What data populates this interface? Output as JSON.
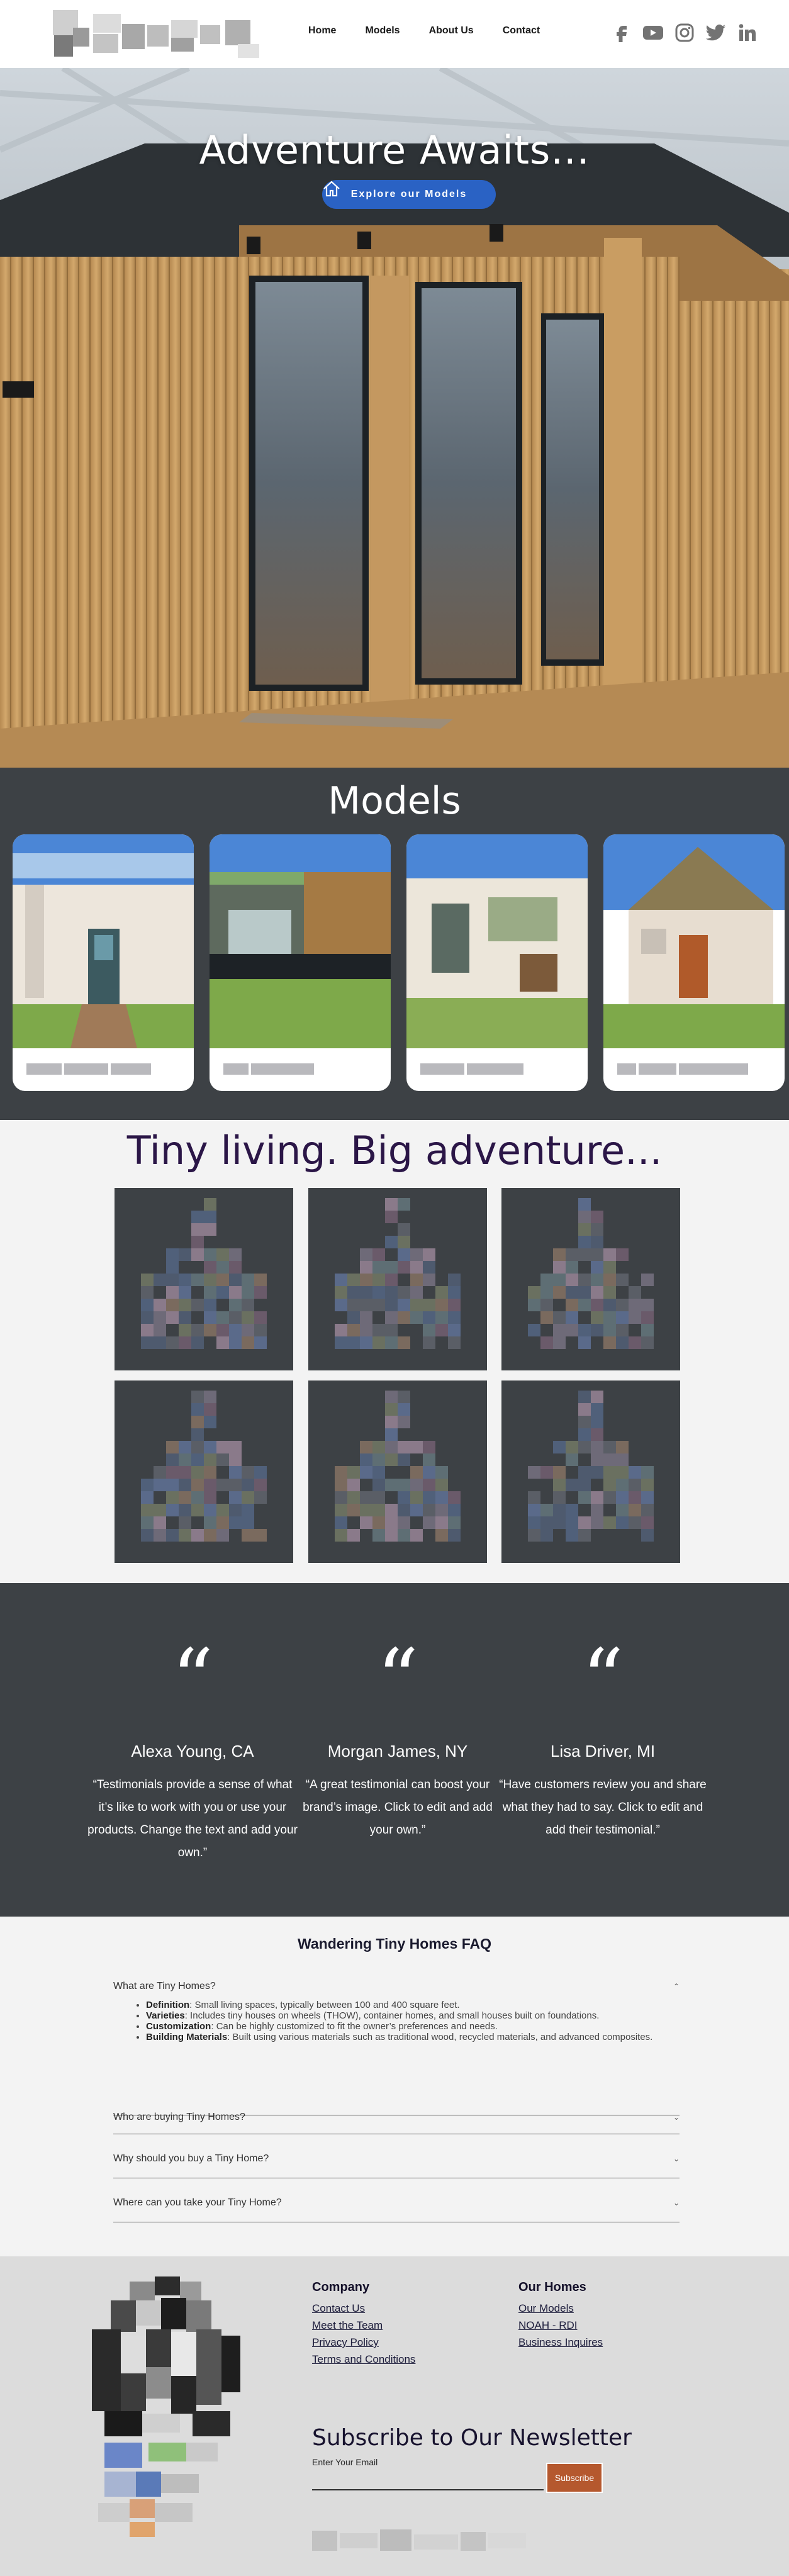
{
  "header": {
    "nav": [
      {
        "label": "Home"
      },
      {
        "label": "Models"
      },
      {
        "label": "About Us"
      },
      {
        "label": "Contact"
      }
    ],
    "social_icons": [
      "facebook-icon",
      "youtube-icon",
      "instagram-icon",
      "twitter-icon",
      "linkedin-icon"
    ]
  },
  "hero": {
    "title": "Adventure Awaits...",
    "button_label": "Explore our Models"
  },
  "models": {
    "title": "Models",
    "cards": [
      {},
      {},
      {},
      {}
    ]
  },
  "tagline": {
    "title": "Tiny living. Big adventure..."
  },
  "testimonials": [
    {
      "quote_mark": "“",
      "name": "Alexa Young, CA",
      "text": "“Testimonials provide a sense of what it’s like to work with you or use your products. Change the text and add your own.”"
    },
    {
      "quote_mark": "“",
      "name": "Morgan James, NY",
      "text": "“A great testimonial can boost your brand’s image. Click to edit and add your own.”"
    },
    {
      "quote_mark": "“",
      "name": "Lisa Driver, MI",
      "text": "“Have customers review you and share what they had to say. Click to edit and add their testimonial.”"
    }
  ],
  "faq": {
    "title": "Wandering Tiny Homes FAQ",
    "items": [
      {
        "question": "What are Tiny Homes?"
      },
      {
        "question": "Who are buying Tiny Homes?"
      },
      {
        "question": "Why should you buy a Tiny Home?"
      },
      {
        "question": "Where can you take your Tiny Home?"
      }
    ],
    "answer_points": [
      {
        "term": "Definition",
        "text": ": Small living spaces, typically between 100 and 400 square feet."
      },
      {
        "term": "Varieties",
        "text": ": Includes tiny houses on wheels (THOW), container homes, and small houses built on foundations."
      },
      {
        "term": "Customization",
        "text": ": Can be highly customized to fit the owner’s preferences and needs."
      },
      {
        "term": "Building Materials",
        "text": ": Built using various materials such as traditional wood, recycled materials, and advanced composites."
      }
    ],
    "expanded_chevron": "⌃",
    "collapsed_chevron": "⌄"
  },
  "footer": {
    "company": {
      "title": "Company",
      "links": [
        "Contact Us",
        "Meet the Team",
        "Privacy Policy",
        "Terms and Conditions"
      ]
    },
    "our_homes": {
      "title": "Our Homes",
      "links": [
        "Our Models",
        "NOAH - RDI",
        "Business Inquires"
      ]
    },
    "newsletter": {
      "title": "Subscribe to Our Newsletter",
      "email_label": "Enter Your Email",
      "button_label": "Subscribe"
    }
  },
  "colors": {
    "dark_section": "#3d4145",
    "accent_blue": "#2a62c4",
    "tagline_purple": "#2b1647",
    "subscribe_orange": "#b5582e"
  }
}
